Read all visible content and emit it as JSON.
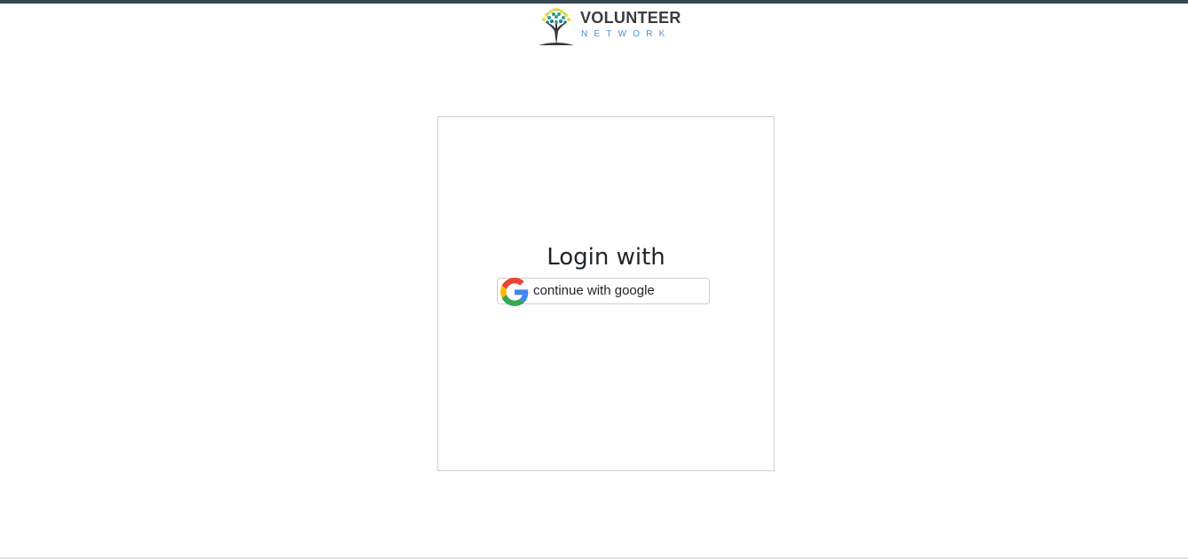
{
  "header": {
    "logo": {
      "title": "VOLUNTEER",
      "subtitle": "NETWORK",
      "icon": "tree-icon"
    }
  },
  "login": {
    "title": "Login with",
    "google_button": {
      "label": "continue with google",
      "icon": "google-icon"
    }
  },
  "colors": {
    "top_strip": "#37474f",
    "logo_subtitle": "#4a90d9",
    "card_border": "#cfcfcf"
  }
}
